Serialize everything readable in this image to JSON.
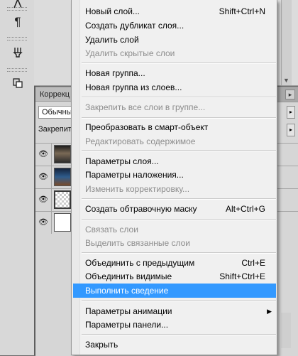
{
  "panel": {
    "tab_label": "Коррекц",
    "blend_mode": "Обычные",
    "lock_label": "Закрепить"
  },
  "toolbar": {
    "tools": [
      "text-tool-icon",
      "paragraph-icon",
      "brush-preset-icon",
      "clone-source-icon"
    ]
  },
  "menu": {
    "items": [
      {
        "label": "Новый слой...",
        "shortcut": "Shift+Ctrl+N",
        "enabled": true
      },
      {
        "label": "Создать дубликат слоя...",
        "shortcut": "",
        "enabled": true
      },
      {
        "label": "Удалить слой",
        "shortcut": "",
        "enabled": true
      },
      {
        "label": "Удалить скрытые слои",
        "shortcut": "",
        "enabled": false
      },
      {
        "label": "Новая группа...",
        "shortcut": "",
        "enabled": true
      },
      {
        "label": "Новая группа из слоев...",
        "shortcut": "",
        "enabled": true
      },
      {
        "label": "Закрепить все слои в группе...",
        "shortcut": "",
        "enabled": false
      },
      {
        "label": "Преобразовать в смарт-объект",
        "shortcut": "",
        "enabled": true
      },
      {
        "label": "Редактировать содержимое",
        "shortcut": "",
        "enabled": false
      },
      {
        "label": "Параметры слоя...",
        "shortcut": "",
        "enabled": true
      },
      {
        "label": "Параметры наложения...",
        "shortcut": "",
        "enabled": true
      },
      {
        "label": "Изменить корректировку...",
        "shortcut": "",
        "enabled": false
      },
      {
        "label": "Создать обтравочную маску",
        "shortcut": "Alt+Ctrl+G",
        "enabled": true
      },
      {
        "label": "Связать слои",
        "shortcut": "",
        "enabled": false
      },
      {
        "label": "Выделить связанные слои",
        "shortcut": "",
        "enabled": false
      },
      {
        "label": "Объединить с предыдущим",
        "shortcut": "Ctrl+E",
        "enabled": true
      },
      {
        "label": "Объединить видимые",
        "shortcut": "Shift+Ctrl+E",
        "enabled": true
      },
      {
        "label": "Выполнить сведение",
        "shortcut": "",
        "enabled": true,
        "highlighted": true
      },
      {
        "label": "Параметры анимации",
        "shortcut": "",
        "enabled": true,
        "submenu": true
      },
      {
        "label": "Параметры панели...",
        "shortcut": "",
        "enabled": true
      },
      {
        "label": "Закрыть",
        "shortcut": "",
        "enabled": true
      }
    ]
  },
  "colors": {
    "highlight": "#3399ff",
    "disabled_text": "#8c8c8c"
  }
}
